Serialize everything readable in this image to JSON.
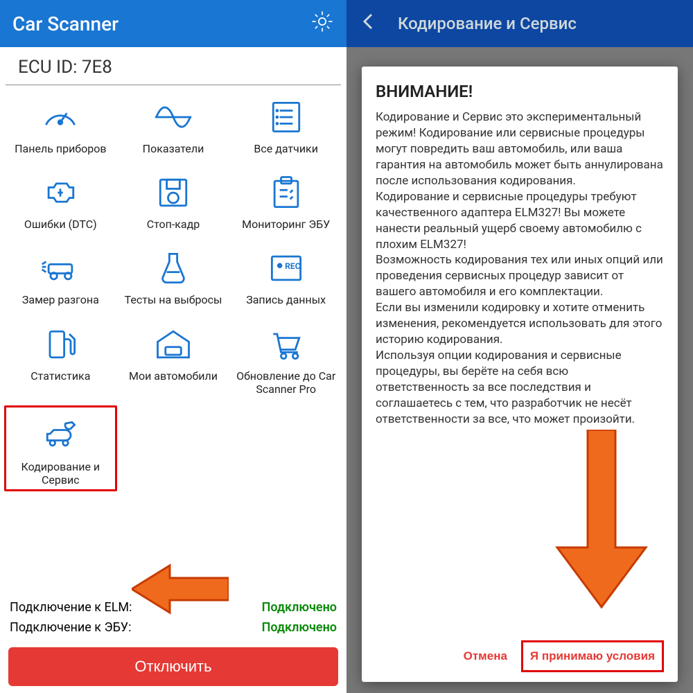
{
  "left": {
    "app_title": "Car Scanner",
    "ecu_label": "ECU ID: 7E8",
    "tiles": [
      {
        "id": "dashboard",
        "label": "Панель приборов"
      },
      {
        "id": "indicators",
        "label": "Показатели"
      },
      {
        "id": "sensors",
        "label": "Все датчики"
      },
      {
        "id": "dtc",
        "label": "Ошибки (DTC)"
      },
      {
        "id": "freeze",
        "label": "Стоп-кадр"
      },
      {
        "id": "ecumon",
        "label": "Мониторинг ЭБУ"
      },
      {
        "id": "accel",
        "label": "Замер разгона"
      },
      {
        "id": "emission",
        "label": "Тесты на выбросы"
      },
      {
        "id": "rec",
        "label": "Запись данных"
      },
      {
        "id": "stats",
        "label": "Статистика"
      },
      {
        "id": "garage",
        "label": "Мои автомобили"
      },
      {
        "id": "upgrade",
        "label": "Обновление до Car Scanner Pro"
      },
      {
        "id": "coding",
        "label": "Кодирование и Сервис"
      }
    ],
    "status": {
      "elm_label": "Подключение к ELM:",
      "ecu_label": "Подключение к ЭБУ:",
      "connected": "Подключено"
    },
    "disconnect": "Отключить"
  },
  "right": {
    "header": "Кодирование и Сервис",
    "dialog": {
      "title": "ВНИМАНИЕ!",
      "body": "Кодирование и Сервис это экспериментальный режим! Кодирование или сервисные процедуры могут повредить ваш автомобиль, или ваша гарантия на автомобиль может быть аннулирована после использования кодирования.\nКодирование и сервисные процедуры требуют качественного адаптера ELM327! Вы можете нанести реальный ущерб своему автомобилю с плохим ELM327!\nВозможность кодирования тех или иных опций или проведения сервисных процедур зависит от вашего автомобиля и его комплектации.\nЕсли вы изменили кодировку и хотите отменить изменения, рекомендуется использовать для этого историю кодирования.\nИспользуя опции кодирования и сервисные процедуры, вы берёте на себя всю ответственность за все последствия и соглашаетесь с тем, что разработчик не несёт ответственности за все, что может произойти.",
      "cancel": "Отмена",
      "accept": "Я принимаю условия"
    }
  }
}
